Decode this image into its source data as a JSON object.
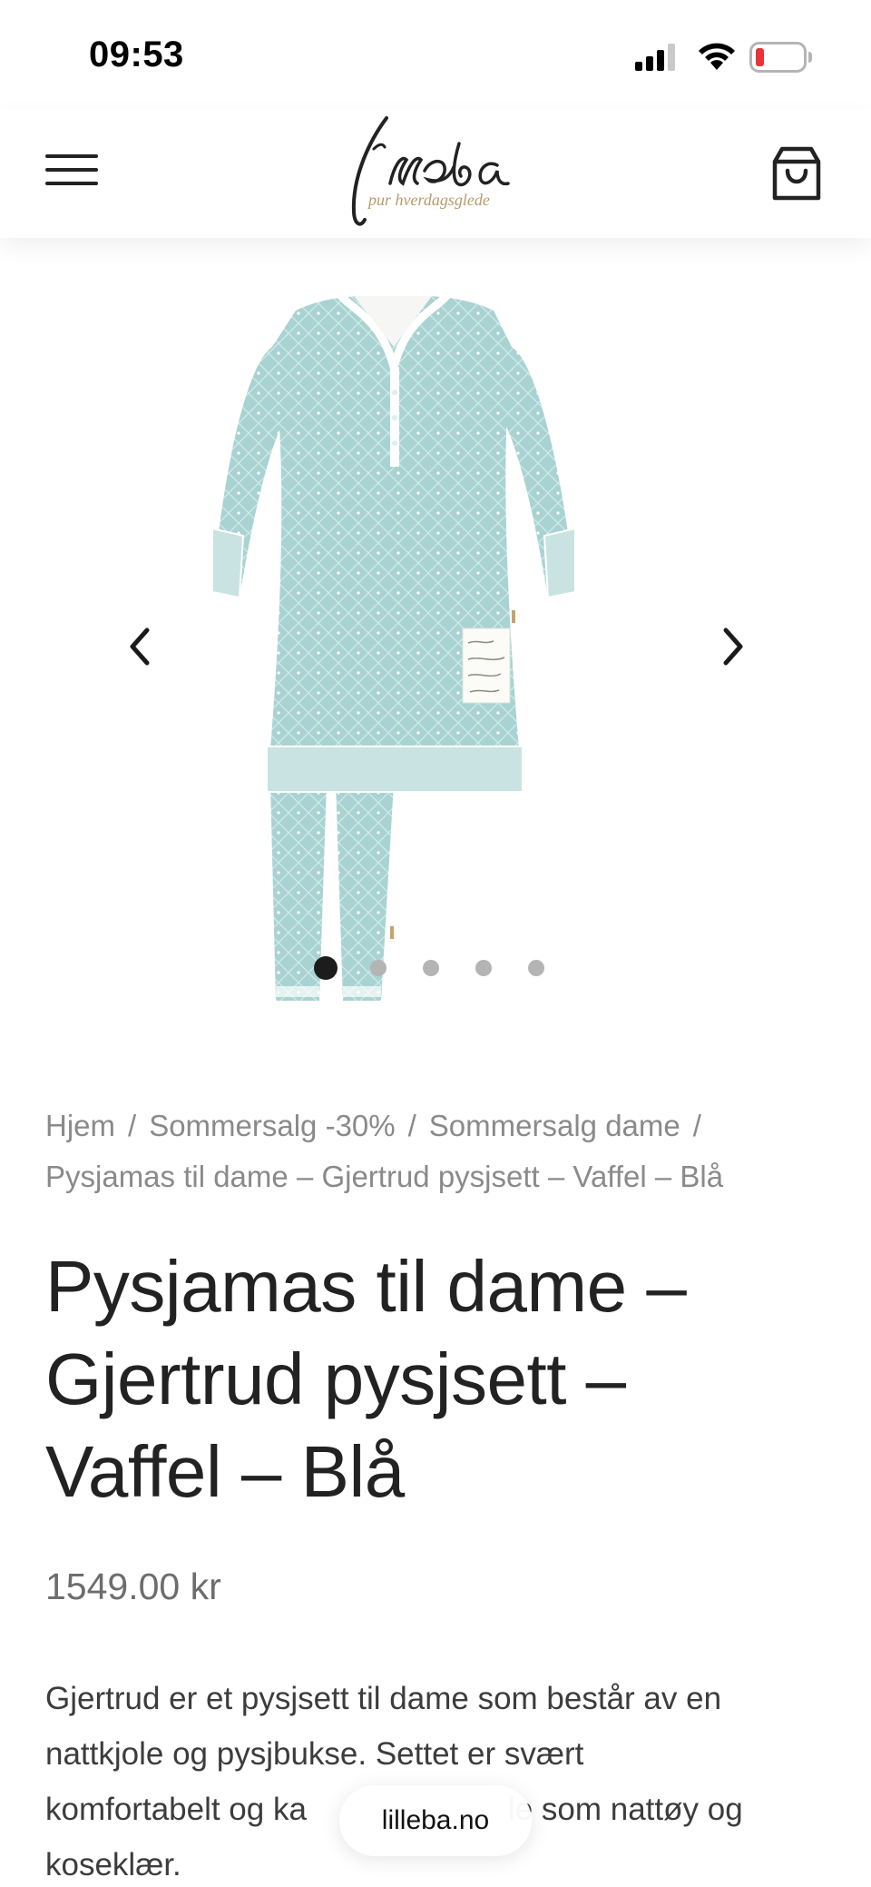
{
  "status_bar": {
    "time": "09:53",
    "signal_icon": "cellular-signal-icon",
    "wifi_icon": "wifi-icon",
    "battery_icon": "battery-low-icon",
    "battery_color": "#e8333b"
  },
  "header": {
    "menu_icon": "hamburger-menu-icon",
    "logo_text": "lilleba",
    "logo_tagline": "pur hverdagsglede",
    "cart_icon": "shopping-bag-icon"
  },
  "gallery": {
    "prev_icon": "chevron-left-icon",
    "next_icon": "chevron-right-icon",
    "slide_count": 5,
    "active_slide": 1,
    "image_color": "#a9d3d2"
  },
  "breadcrumb": {
    "items": [
      "Hjem",
      "Sommersalg -30%",
      "Sommersalg dame"
    ],
    "separator": "/",
    "current": "Pysjamas til dame – Gjertrud pysjsett – Vaffel – Blå"
  },
  "product": {
    "title_lines": [
      "Pysjamas til dame –",
      "Gjertrud pysjsett –",
      "Vaffel – Blå"
    ],
    "price": "1549.00 kr",
    "description_lines": [
      "Gjertrud er et pysjsett til dame som består av en",
      "nattkjole og pysjbukse. Settet er svært",
      "komfortabelt og ka",
      "le som nattøy og",
      "koseklær."
    ]
  },
  "browser": {
    "url": "lilleba.no"
  },
  "colors": {
    "text": "#222222",
    "muted": "#8a8a8a",
    "dot_active": "#1c1c1c",
    "dot_inactive": "#b4b4b4"
  }
}
